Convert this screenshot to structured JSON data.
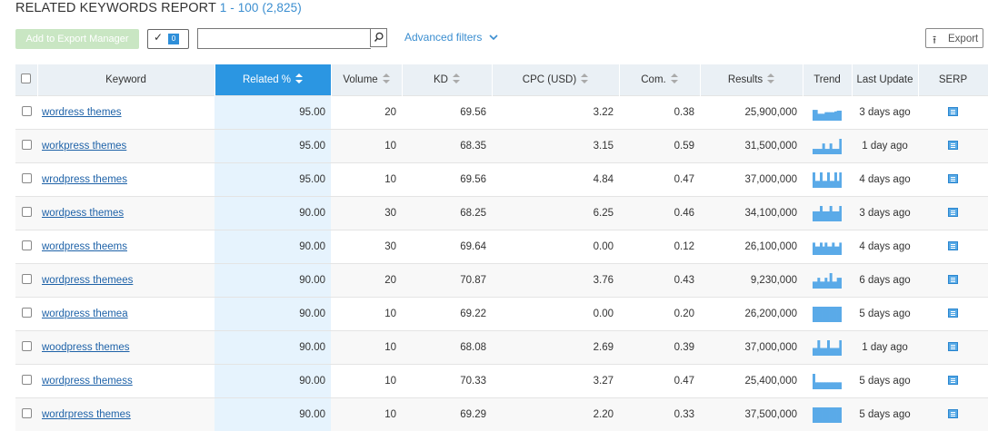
{
  "header": {
    "title": "RELATED KEYWORDS REPORT",
    "range": "1 - 100 (2,825)"
  },
  "toolbar": {
    "add_export_label": "Add to Export Manager",
    "selected_count": "0",
    "search_value": "",
    "advanced_filters_label": "Advanced filters",
    "export_label": "Export"
  },
  "table": {
    "columns": [
      "Keyword",
      "Related %",
      "Volume",
      "KD",
      "CPC (USD)",
      "Com.",
      "Results",
      "Trend",
      "Last Update",
      "SERP"
    ],
    "rows": [
      {
        "keyword": "wordress themes",
        "related": "95.00",
        "volume": "20",
        "kd": "69.56",
        "cpc": "3.22",
        "com": "0.38",
        "results": "25,900,000",
        "trend": [
          0.7,
          0.7,
          0.45,
          0.45,
          0.45,
          0.55,
          0.55,
          0.55,
          0.55,
          0.6,
          0.65,
          0.65
        ],
        "last_update": "3 days ago"
      },
      {
        "keyword": "workpress themes",
        "related": "95.00",
        "volume": "10",
        "kd": "68.35",
        "cpc": "3.15",
        "com": "0.59",
        "results": "31,500,000",
        "trend": [
          0.35,
          0.35,
          0.35,
          0.35,
          0.7,
          0.35,
          0.35,
          0.7,
          0.35,
          0.35,
          0.35,
          1.0
        ],
        "last_update": "1 day ago"
      },
      {
        "keyword": "wrodpress themes",
        "related": "95.00",
        "volume": "10",
        "kd": "69.56",
        "cpc": "4.84",
        "com": "0.47",
        "results": "37,000,000",
        "trend": [
          1.0,
          0.45,
          0.45,
          1.0,
          0.45,
          0.45,
          1.0,
          0.45,
          0.45,
          1.0,
          0.45,
          1.0
        ],
        "last_update": "4 days ago"
      },
      {
        "keyword": "wordpess themes",
        "related": "90.00",
        "volume": "30",
        "kd": "68.25",
        "cpc": "6.25",
        "com": "0.46",
        "results": "34,100,000",
        "trend": [
          0.65,
          0.65,
          0.65,
          1.0,
          0.65,
          0.65,
          0.65,
          1.0,
          0.65,
          0.65,
          0.65,
          1.0
        ],
        "last_update": "3 days ago"
      },
      {
        "keyword": "wordpress theems",
        "related": "90.00",
        "volume": "30",
        "kd": "69.64",
        "cpc": "0.00",
        "com": "0.12",
        "results": "26,100,000",
        "trend": [
          0.8,
          0.55,
          0.55,
          0.8,
          0.55,
          0.8,
          0.55,
          0.55,
          0.8,
          0.55,
          0.55,
          0.8
        ],
        "last_update": "4 days ago"
      },
      {
        "keyword": "wordpress themees",
        "related": "90.00",
        "volume": "20",
        "kd": "70.87",
        "cpc": "3.76",
        "com": "0.43",
        "results": "9,230,000",
        "trend": [
          0.45,
          0.45,
          0.7,
          0.45,
          0.45,
          0.7,
          0.45,
          1.0,
          0.45,
          0.45,
          0.7,
          0.7
        ],
        "last_update": "6 days ago"
      },
      {
        "keyword": "wordpress themea",
        "related": "90.00",
        "volume": "10",
        "kd": "69.22",
        "cpc": "0.00",
        "com": "0.20",
        "results": "26,200,000",
        "trend": [
          1,
          1,
          1,
          1,
          1,
          1,
          1,
          1,
          1,
          1,
          1,
          1
        ],
        "last_update": "5 days ago"
      },
      {
        "keyword": "woodpress themes",
        "related": "90.00",
        "volume": "10",
        "kd": "68.08",
        "cpc": "2.69",
        "com": "0.39",
        "results": "37,000,000",
        "trend": [
          0.5,
          0.5,
          1.0,
          0.5,
          0.5,
          0.5,
          1.0,
          0.5,
          0.5,
          0.5,
          0.5,
          1.0
        ],
        "last_update": "1 day ago"
      },
      {
        "keyword": "wordpress themess",
        "related": "90.00",
        "volume": "10",
        "kd": "70.33",
        "cpc": "3.27",
        "com": "0.47",
        "results": "25,400,000",
        "trend": [
          1.0,
          0.45,
          0.45,
          0.45,
          0.45,
          0.45,
          0.45,
          0.45,
          0.45,
          0.45,
          0.45,
          0.45
        ],
        "last_update": "5 days ago"
      },
      {
        "keyword": "wordrpress themes",
        "related": "90.00",
        "volume": "10",
        "kd": "69.29",
        "cpc": "2.20",
        "com": "0.33",
        "results": "37,500,000",
        "trend": [
          1,
          1,
          1,
          1,
          1,
          1,
          1,
          1,
          1,
          1,
          1,
          1
        ],
        "last_update": "5 days ago"
      }
    ]
  },
  "colors": {
    "accent": "#2b96e2",
    "link": "#1e62a8",
    "trend_bar": "#5aaae8",
    "active_column_bg": "#e6f3fd"
  }
}
